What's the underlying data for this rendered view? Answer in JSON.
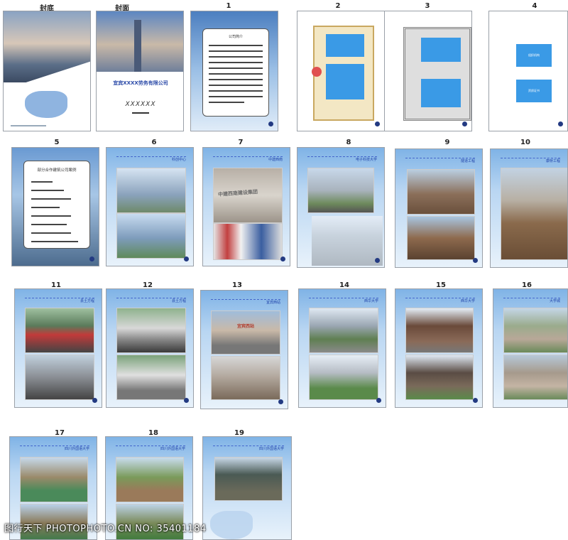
{
  "labels": {
    "p_back": "封底",
    "p_front": "封面",
    "p1": "1",
    "p2": "2",
    "p3": "3",
    "p4": "4",
    "p5": "5",
    "p6": "6",
    "p7": "7",
    "p8": "8",
    "p9": "9",
    "p10": "10",
    "p11": "11",
    "p12": "12",
    "p13": "13",
    "p14": "14",
    "p15": "15",
    "p16": "16",
    "p17": "17",
    "p18": "18",
    "p19": "19"
  },
  "front": {
    "company": "宜宾XXXX劳务有限公司",
    "sub": "XXXXXX"
  },
  "p1": {
    "title": "公司简介"
  },
  "p4": {
    "btn1": "组织机构",
    "btn2": "资质证书"
  },
  "p5": {
    "title": "部分合作建筑公司案例"
  },
  "headers": {
    "h6": "科创中心",
    "h7": "中建西南",
    "h8": "电子科技大学",
    "h9": "隧道工程",
    "h10": "康桥工程",
    "h11": "县土方程",
    "h12": "县土方程",
    "h13": "宜宾西站",
    "h14": "西华大学",
    "h15": "西华大学",
    "h16": "大学城",
    "h17": "四川外国语大学",
    "h18": "四川外国语大学",
    "h19": "四川外国语大学"
  },
  "p7_sign": "中建西南建设集团",
  "p13_sign": "宜宾西站",
  "watermark": "图行天下 PHOTOPHOTO.CN  NO: 35401184"
}
